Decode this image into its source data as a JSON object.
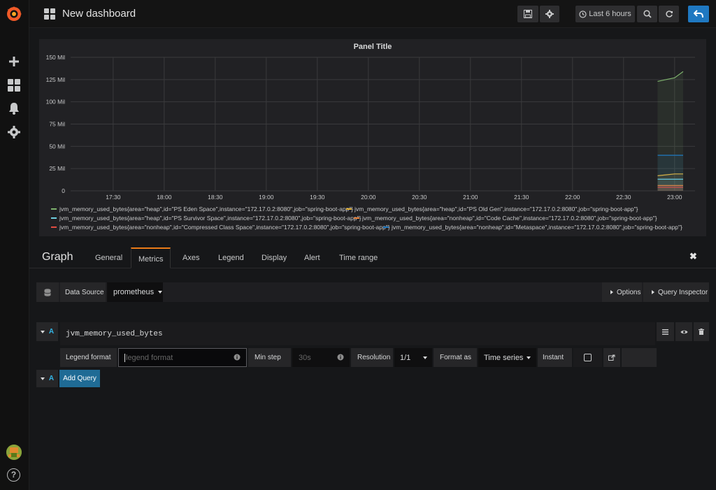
{
  "navbar": {
    "title": "New dashboard",
    "time_range_label": "Last 6 hours"
  },
  "panel": {
    "title": "Panel Title"
  },
  "chart_data": {
    "type": "line",
    "title": "Panel Title",
    "x_ticks": [
      "17:30",
      "18:00",
      "18:30",
      "19:00",
      "19:30",
      "20:00",
      "20:30",
      "21:00",
      "21:30",
      "22:00",
      "22:30",
      "23:00"
    ],
    "y_ticks": [
      "0",
      "25 Mil",
      "50 Mil",
      "75 Mil",
      "100 Mil",
      "125 Mil",
      "150 Mil"
    ],
    "ylim": [
      0,
      150000000
    ],
    "x": [
      "22:50",
      "22:55",
      "23:00",
      "23:05"
    ],
    "series": [
      {
        "name": "jvm_memory_used_bytes{area=\"heap\",id=\"PS Eden Space\",instance=\"172.17.0.2:8080\",job=\"spring-boot-app\"}",
        "color": "#7eb26d",
        "values": [
          123000000,
          125000000,
          127000000,
          134000000
        ]
      },
      {
        "name": "jvm_memory_used_bytes{area=\"heap\",id=\"PS Old Gen\",instance=\"172.17.0.2:8080\",job=\"spring-boot-app\"}",
        "color": "#eab839",
        "values": [
          17000000,
          18000000,
          19000000,
          19000000
        ]
      },
      {
        "name": "jvm_memory_used_bytes{area=\"heap\",id=\"PS Survivor Space\",instance=\"172.17.0.2:8080\",job=\"spring-boot-app\"}",
        "color": "#6ed0e0",
        "values": [
          13000000,
          13000000,
          13000000,
          13000000
        ]
      },
      {
        "name": "jvm_memory_used_bytes{area=\"nonheap\",id=\"Code Cache\",instance=\"172.17.0.2:8080\",job=\"spring-boot-app\"}",
        "color": "#ef843c",
        "values": [
          6000000,
          6000000,
          6000000,
          6000000
        ]
      },
      {
        "name": "jvm_memory_used_bytes{area=\"nonheap\",id=\"Compressed Class Space\",instance=\"172.17.0.2:8080\",job=\"spring-boot-app\"}",
        "color": "#e24d42",
        "values": [
          4000000,
          4000000,
          4000000,
          4000000
        ]
      },
      {
        "name": "jvm_memory_used_bytes{area=\"nonheap\",id=\"Metaspace\",instance=\"172.17.0.2:8080\",job=\"spring-boot-app\"}",
        "color": "#1f78c1",
        "values": [
          40000000,
          40000000,
          40000000,
          40000000
        ]
      }
    ]
  },
  "editor": {
    "title": "Graph",
    "tabs": [
      "General",
      "Metrics",
      "Axes",
      "Legend",
      "Display",
      "Alert",
      "Time range"
    ]
  },
  "datasource": {
    "label": "Data Source",
    "value": "prometheus",
    "options_label": "Options",
    "inspector_label": "Query Inspector"
  },
  "query": {
    "ref": "A",
    "expr": "jvm_memory_used_bytes",
    "legend_label": "Legend format",
    "legend_placeholder": "legend format",
    "min_step_label": "Min step",
    "min_step_placeholder": "30s",
    "resolution_label": "Resolution",
    "resolution_value": "1/1",
    "format_label": "Format as",
    "format_value": "Time series",
    "instant_label": "Instant"
  },
  "add_query": {
    "ref": "A",
    "label": "Add Query"
  },
  "colors": {
    "brand_orange": "#eb7b18",
    "primary_blue": "#1f78c1",
    "query_letter": "#33b5e5"
  }
}
